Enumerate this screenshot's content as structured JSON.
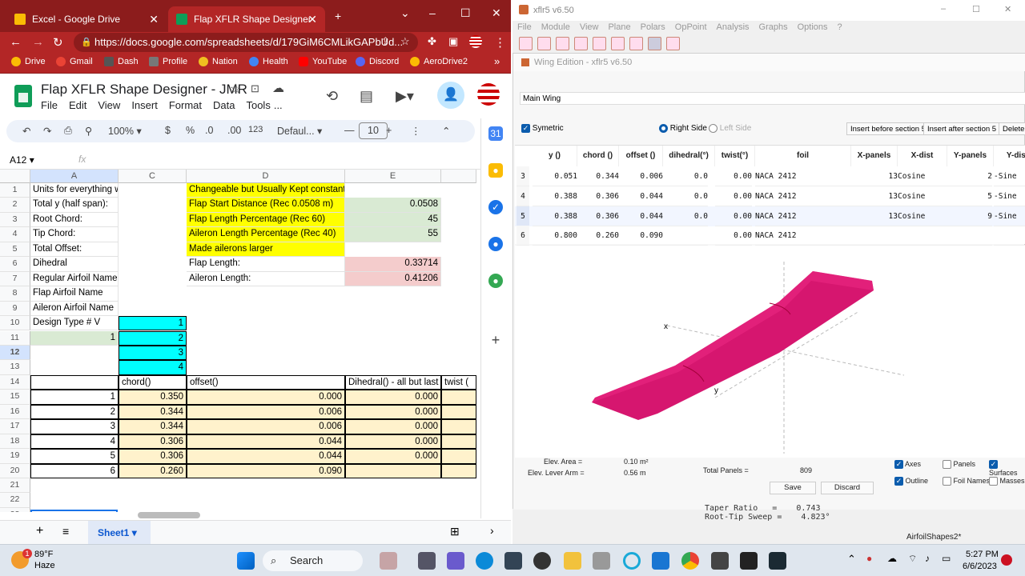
{
  "chrome": {
    "tabs": [
      {
        "label": "Excel - Google Drive"
      },
      {
        "label": "Flap XFLR Shape Designer - JMR"
      }
    ],
    "new_tab": "+",
    "url": "https://docs.google.com/spreadsheets/d/179GiM6CMLikGAPbUd...",
    "bookmarks": [
      "Drive",
      "Gmail",
      "Dash",
      "Profile",
      "Nation",
      "Health",
      "YouTube",
      "Discord",
      "AeroDrive2"
    ],
    "bookmarks_more": "»"
  },
  "sheets": {
    "title": "Flap XFLR Shape Designer - JMR",
    "menus": [
      "File",
      "Edit",
      "View",
      "Insert",
      "Format",
      "Data",
      "Tools",
      "..."
    ],
    "zoom": "100%",
    "currency": "$",
    "percent": "%",
    "dec_down": ".0",
    "dec_up": ".00",
    "format_123": "123",
    "font": "Defaul...",
    "font_size": "10",
    "name_box": "A12",
    "fx": "fx",
    "col_headers": [
      "A",
      "C",
      "D",
      "E"
    ],
    "row_headers": [
      "1",
      "2",
      "3",
      "4",
      "5",
      "6",
      "7",
      "8",
      "9",
      "10",
      "11",
      "12",
      "13",
      "14",
      "15",
      "16",
      "17",
      "18",
      "19",
      "20",
      "21",
      "22",
      "23"
    ],
    "colA": [
      "Units for everything w",
      "Total y (half span):",
      "Root Chord:",
      "Tip Chord:",
      "Total Offset:",
      "Dihedral",
      "Regular Airfoil Name",
      "Flap Airfoil Name",
      "Aileron Airfoil Name",
      "Design Type # V",
      "1"
    ],
    "colC_types": [
      "1",
      "2",
      "3",
      "4"
    ],
    "colD": [
      "Changeable but Usually Kept constant",
      "Flap Start Distance (Rec 0.0508 m)",
      "Flap Length Percentage (Rec 60)",
      "Aileron Length Percentage (Rec 40)",
      "Made ailerons larger",
      "Flap Length:",
      "Aileron Length:"
    ],
    "colE": [
      "0.0508",
      "45",
      "55",
      "0.33714",
      "0.41206"
    ],
    "table_headers": [
      "chord()",
      "offset()",
      "Dihedral() - all but last",
      "twist ("
    ],
    "table_index": [
      "1",
      "2",
      "3",
      "4",
      "5",
      "6"
    ],
    "table_chord": [
      "0.350",
      "0.344",
      "0.344",
      "0.306",
      "0.306",
      "0.260"
    ],
    "table_offset": [
      "0.000",
      "0.006",
      "0.006",
      "0.044",
      "0.044",
      "0.090"
    ],
    "table_dihedral": [
      "0.000",
      "0.000",
      "0.000",
      "0.000",
      "0.000",
      ""
    ],
    "sheet_tab": "Sheet1"
  },
  "xflr": {
    "title": "xflr5 v6.50",
    "menus": [
      "File",
      "Module",
      "View",
      "Plane",
      "Polars",
      "OpPoint",
      "Analysis",
      "Graphs",
      "Options",
      "?"
    ],
    "wing_title": "Wing Edition - xflr5 v6.50",
    "wing_name": "Main Wing",
    "symetric": "Symetric",
    "right_side": "Right Side",
    "left_side": "Left Side",
    "insert_before": "Insert before section 5",
    "insert_after": "Insert after section 5",
    "delete": "Delete se",
    "headers": [
      "y ()",
      "chord ()",
      "offset ()",
      "dihedral(°)",
      "twist(°)",
      "foil",
      "X-panels",
      "X-dist",
      "Y-panels",
      "Y-dist"
    ],
    "rows": [
      [
        "3",
        "0.051",
        "0.344",
        "0.006",
        "0.0",
        "0.00",
        "NACA 2412",
        "13",
        "Cosine",
        "2",
        "-Sine"
      ],
      [
        "4",
        "0.388",
        "0.306",
        "0.044",
        "0.0",
        "0.00",
        "NACA 2412",
        "13",
        "Cosine",
        "5",
        "-Sine"
      ],
      [
        "5",
        "0.388",
        "0.306",
        "0.044",
        "0.0",
        "0.00",
        "NACA 2412",
        "13",
        "Cosine",
        "9",
        "-Sine"
      ],
      [
        "6",
        "0.800",
        "0.260",
        "0.090",
        "",
        "0.00",
        "NACA 2412",
        "",
        "",
        "",
        ""
      ]
    ],
    "axis_x": "x",
    "axis_y": "y",
    "elev_area_label": "Elev. Area =",
    "elev_area": "0.10 m²",
    "elev_lever_label": "Elev. Lever Arm =",
    "elev_lever": "0.56 m",
    "total_panels_label": "Total Panels =",
    "total_panels": "809",
    "save": "Save",
    "discard": "Discard",
    "opts": [
      "Axes",
      "Panels",
      "Surfaces",
      "Outline",
      "Foil Names",
      "Masses"
    ],
    "taper_label": "Taper Ratio",
    "taper": "0.743",
    "sweep_label": "Root-Tip Sweep",
    "sweep": "4.823°",
    "status_file": "AirfoilShapes2*"
  },
  "taskbar": {
    "temp": "89°F",
    "weather": "Haze",
    "badge": "1",
    "search": "Search",
    "time": "5:27 PM",
    "date": "6/6/2023"
  }
}
